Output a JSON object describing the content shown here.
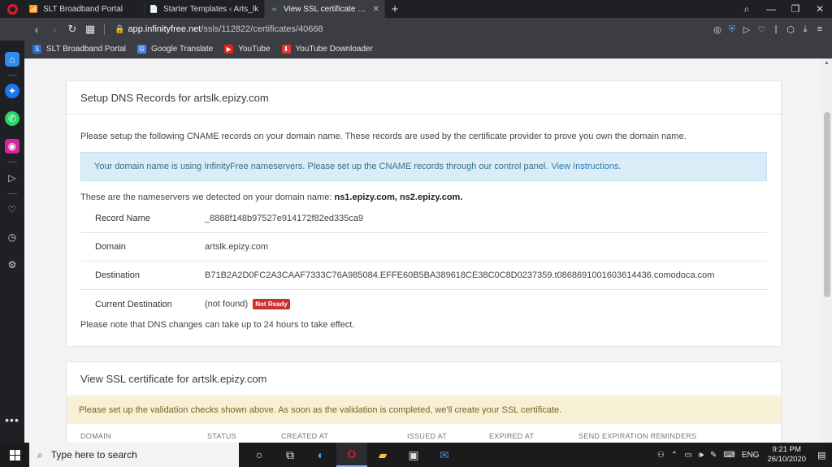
{
  "browser": {
    "tabs": [
      {
        "title": "SLT Broadband Portal",
        "active": false
      },
      {
        "title": "Starter Templates ‹ Arts_lk",
        "active": false
      },
      {
        "title": "View SSL certificate for arts",
        "active": true
      }
    ],
    "url_domain": "app.infinityfree.net",
    "url_path": "/ssls/112822/certificates/40668",
    "bookmarks": [
      {
        "label": "SLT Broadband Portal",
        "icon": "slt-icon"
      },
      {
        "label": "Google Translate",
        "icon": "google-translate-icon"
      },
      {
        "label": "YouTube",
        "icon": "youtube-icon"
      },
      {
        "label": "YouTube Downloader",
        "icon": "youtube-downloader-icon"
      }
    ]
  },
  "dns_card": {
    "title": "Setup DNS Records for artslk.epizy.com",
    "intro": "Please setup the following CNAME records on your domain name. These records are used by the certificate provider to prove you own the domain name.",
    "info_text": "Your domain name is using InfinityFree nameservers. Please set up the CNAME records through our control panel.",
    "info_link": "View Instructions.",
    "ns_prefix": "These are the nameservers we detected on your domain name:",
    "ns_values": "ns1.epizy.com, ns2.epizy.com.",
    "records": [
      {
        "key": "Record Name",
        "value": "_8888f148b97527e914172f82ed335ca9"
      },
      {
        "key": "Domain",
        "value": "artslk.epizy.com"
      },
      {
        "key": "Destination",
        "value": "B71B2A2D0FC2A3CAAF7333C76A985084.EFFE60B5BA389618CE38C0C8D0237359.t0868691001603614436.comodoca.com"
      },
      {
        "key": "Current Destination",
        "value": "(not found)"
      }
    ],
    "status_badge": "Not Ready",
    "note": "Please note that DNS changes can take up to 24 hours to take effect."
  },
  "ssl_card": {
    "title": "View SSL certificate for artslk.epizy.com",
    "warning": "Please set up the validation checks shown above. As soon as the validation is completed, we'll create your SSL certificate.",
    "columns": [
      "DOMAIN",
      "STATUS",
      "CREATED AT",
      "ISSUED AT",
      "EXPIRED AT",
      "SEND EXPIRATION REMINDERS"
    ]
  },
  "taskbar": {
    "search_placeholder": "Type here to search",
    "lang": "ENG",
    "time": "9:21 PM",
    "date": "26/10/2020"
  }
}
